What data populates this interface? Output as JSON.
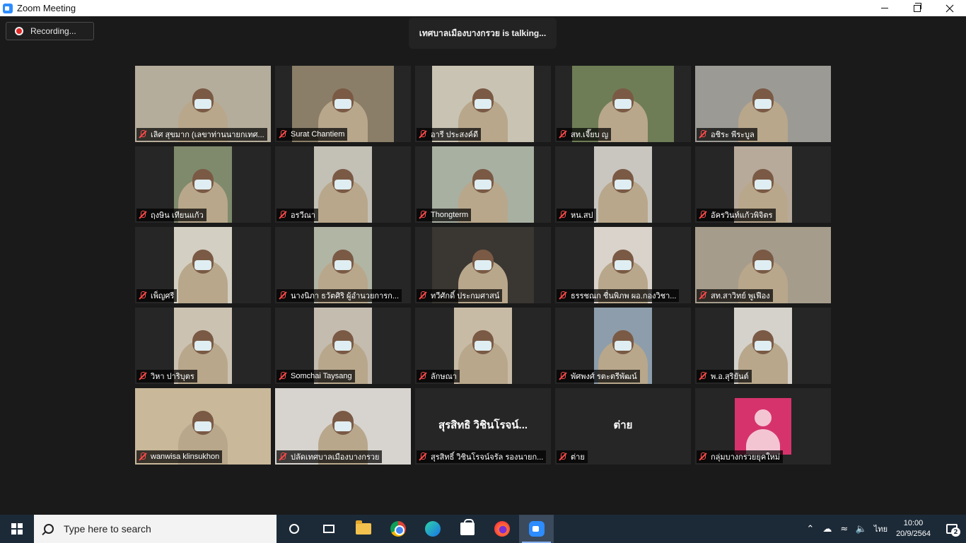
{
  "window": {
    "title": "Zoom Meeting"
  },
  "meeting": {
    "recording_label": "Recording...",
    "talking_label": "เทศบาลเมืองบางกรวย is talking..."
  },
  "participants": [
    {
      "name": "เลิศ สุขมาก (เลขาท่านนายกเทศ...",
      "bg": "#b5ad9b"
    },
    {
      "name": "Surat Chantiem",
      "bg": "#8a7e68"
    },
    {
      "name": "อารี ประสงค์ดี",
      "bg": "#c9c3b3"
    },
    {
      "name": "สท.เจี๊ยบ ญ",
      "bg": "#6e7d55"
    },
    {
      "name": "อชิระ พีระบูล",
      "bg": "#9c9a95"
    },
    {
      "name": "ฤงษิน เทียนแก้ว",
      "bg": "#7f8a6c"
    },
    {
      "name": "อรวีณา",
      "bg": "#c3c0b6"
    },
    {
      "name": "Thongterm",
      "bg": "#a8b0a2"
    },
    {
      "name": "หน.สป",
      "bg": "#c9c6c0"
    },
    {
      "name": "อัครวินท์แก้วพิจิตร",
      "bg": "#b7aa9a"
    },
    {
      "name": "เพ็ญศรี",
      "bg": "#d3cfc2"
    },
    {
      "name": "นางนิภา ธวัตศิริ ผู้อำนวยการก...",
      "bg": "#b0b5a4"
    },
    {
      "name": "ทวีศักดิ์ ประกมศาสน์",
      "bg": "#3a3632"
    },
    {
      "name": "ธรรชณก ชื่นพิภพ ผอ.กองวิชา...",
      "bg": "#d9d3cb"
    },
    {
      "name": "สท.สาวิทย์ พูเฟือง",
      "bg": "#a59c8c"
    },
    {
      "name": "วิหา ปาริบุตร",
      "bg": "#ccc2b2"
    },
    {
      "name": "Somchai Taysang",
      "bg": "#c5bcb0"
    },
    {
      "name": "ลักษณา",
      "bg": "#c8bba6"
    },
    {
      "name": "พัศพงศ์ รตะตรีพัฒน์",
      "bg": "#8d9dab"
    },
    {
      "name": "พ.อ.สุริยันต์",
      "bg": "#d5d2cc"
    },
    {
      "name": "wanwisa klinsukhon",
      "bg": "#c9b899"
    },
    {
      "name": "ปลัดเทศบาลเมืองบางกรวย",
      "bg": "#d7d4cf"
    },
    {
      "name": "สุรสิทธิ์ วิชินโรจน์จรัล รองนายก...",
      "big_name": "สุรสิทธิ วิชินโรจน์...",
      "bg": "#262626"
    },
    {
      "name": "ต่าย",
      "big_name": "ต่าย",
      "bg": "#262626"
    },
    {
      "name": "กลุ่มบางกรวยยุคใหม่",
      "avatar": true,
      "bg": "#262626"
    }
  ],
  "taskbar": {
    "search_placeholder": "Type here to search",
    "apps": [
      "cortana-icon",
      "task-view-icon",
      "file-explorer-icon",
      "chrome-icon",
      "edge-icon",
      "store-icon",
      "firefox-icon",
      "zoom-icon"
    ],
    "language": "ไทย",
    "time": "10:00",
    "date": "20/9/2564",
    "notification_count": "2"
  }
}
